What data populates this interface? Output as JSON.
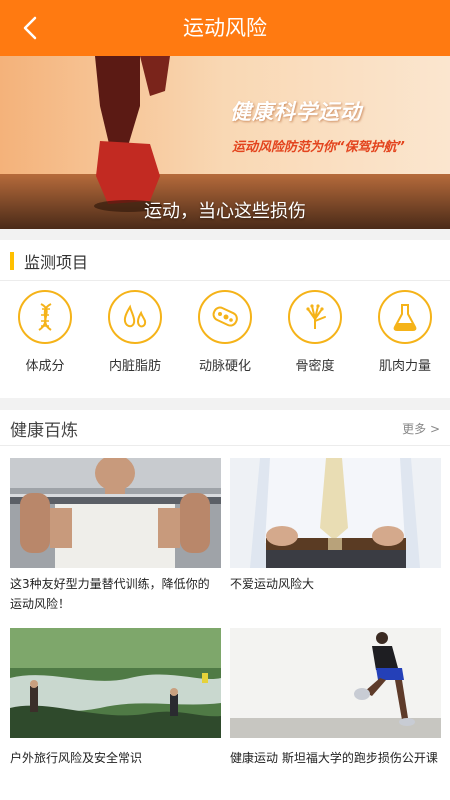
{
  "header": {
    "title": "运动风险",
    "back_icon": "chevron-left-icon"
  },
  "banner": {
    "headline": "健康科学运动",
    "slogan": "运动风险防范为你“保驾护航”",
    "caption": "运动，当心这些损伤"
  },
  "monitor": {
    "title": "监测项目",
    "items": [
      {
        "label": "体成分",
        "icon": "dna-icon"
      },
      {
        "label": "内脏脂肪",
        "icon": "fat-drops-icon"
      },
      {
        "label": "动脉硬化",
        "icon": "artery-icon"
      },
      {
        "label": "骨密度",
        "icon": "bone-hand-icon"
      },
      {
        "label": "肌肉力量",
        "icon": "flask-icon"
      }
    ]
  },
  "health": {
    "title": "健康百炼",
    "more": "更多 >",
    "articles": [
      {
        "caption": "这3种友好型力量替代训练，降低你的运动风险！"
      },
      {
        "caption": "不爱运动风险大"
      },
      {
        "caption": "户外旅行风险及安全常识"
      },
      {
        "caption": "健康运动 斯坦福大学的跑步损伤公开课"
      }
    ]
  },
  "colors": {
    "accent": "#ff7a11",
    "icon_ring": "#f5b319"
  }
}
